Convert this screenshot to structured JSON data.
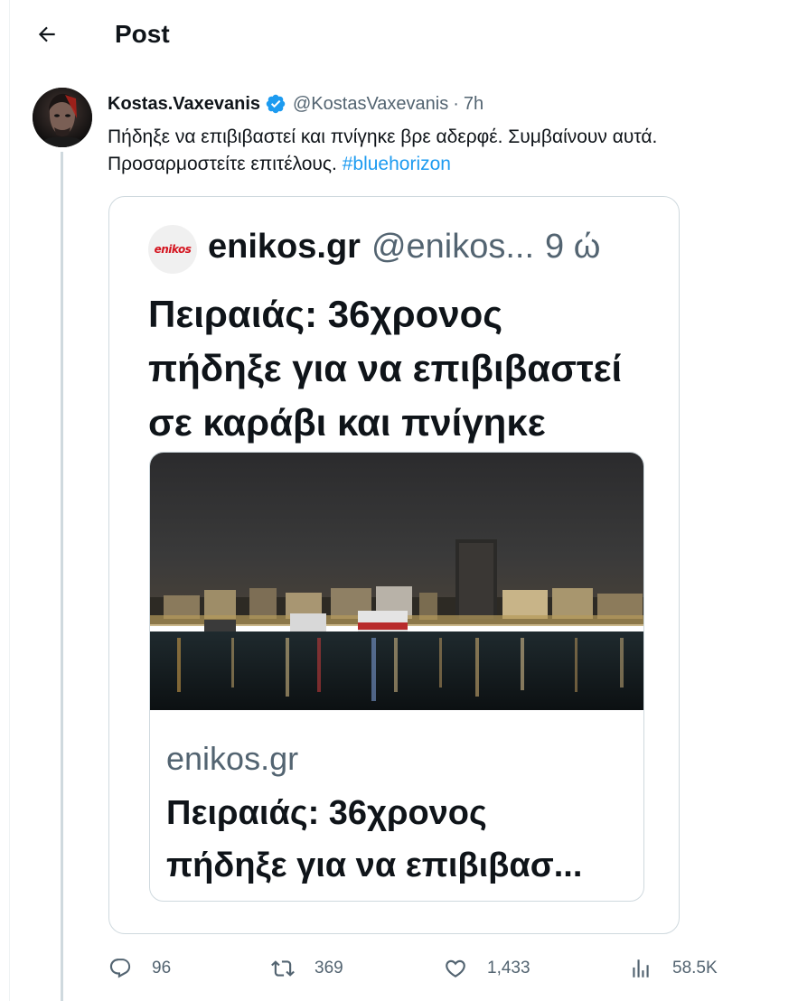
{
  "header": {
    "title": "Post"
  },
  "tweet": {
    "author_name": "Kostas.Vaxevanis",
    "handle": "@KostasVaxevanis",
    "separator": "·",
    "time": "7h",
    "text_line1": "Πήδηξε να επιβιβαστεί και πνίγηκε βρε αδερφέ. Συμβαίνουν αυτά.",
    "text_line2": "Προσαρμοστείτε επιτέλους.",
    "hashtag": "#bluehorizon"
  },
  "quoted": {
    "logo_text": "enikos",
    "name": "enikos.gr",
    "handle": "@enikos...",
    "time": "9 ώ",
    "headline_lines": [
      "Πειραιάς: 36χρονος",
      "πήδηξε για να επιβιβαστεί",
      "σε καράβι και πνίγηκε"
    ],
    "link_domain": "enikos.gr",
    "link_title_lines": [
      "Πειραιάς: 36χρονος",
      "πήδηξε για να επιβιβασ..."
    ]
  },
  "actions": {
    "replies": "96",
    "reposts": "369",
    "likes": "1,433",
    "views": "58.5K"
  },
  "colors": {
    "accent": "#1d9bf0",
    "secondary_text": "#536471",
    "border": "#cfd9de",
    "logo_red": "#d4141f"
  },
  "icons": [
    "back-arrow-icon",
    "verified-badge-icon",
    "reply-icon",
    "repost-icon",
    "like-icon",
    "views-icon"
  ]
}
